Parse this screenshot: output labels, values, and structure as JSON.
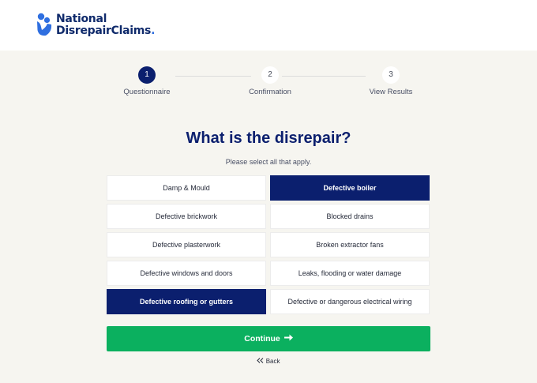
{
  "brand": {
    "name_line1": "National",
    "name_line2": "DisrepairClaims",
    "name_suffix": ".",
    "accent_color": "#2f6fe0",
    "primary_color": "#0b1f6e"
  },
  "steps": [
    {
      "number": "1",
      "label": "Questionnaire",
      "active": true
    },
    {
      "number": "2",
      "label": "Confirmation",
      "active": false
    },
    {
      "number": "3",
      "label": "View Results",
      "active": false
    }
  ],
  "question": {
    "title": "What is the disrepair?",
    "subtitle": "Please select all that apply."
  },
  "options": [
    {
      "label": "Damp & Mould",
      "selected": false
    },
    {
      "label": "Defective boiler",
      "selected": true
    },
    {
      "label": "Defective brickwork",
      "selected": false
    },
    {
      "label": "Blocked drains",
      "selected": false
    },
    {
      "label": "Defective plasterwork",
      "selected": false
    },
    {
      "label": "Broken extractor fans",
      "selected": false
    },
    {
      "label": "Defective windows and doors",
      "selected": false
    },
    {
      "label": "Leaks, flooding or water damage",
      "selected": false
    },
    {
      "label": "Defective roofing or gutters",
      "selected": true
    },
    {
      "label": "Defective or dangerous electrical wiring",
      "selected": false
    }
  ],
  "actions": {
    "continue_label": "Continue",
    "continue_icon": "arrow-right-icon",
    "continue_color": "#0bb05f",
    "back_label": "Back",
    "back_icon": "double-chevron-left-icon"
  }
}
